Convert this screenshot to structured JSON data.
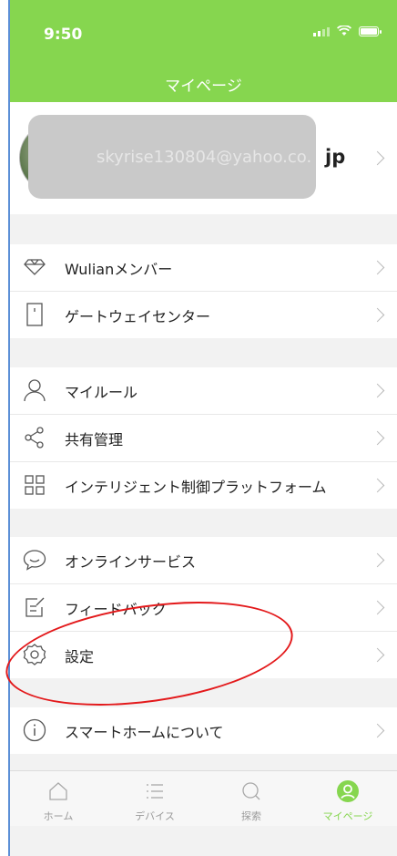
{
  "status": {
    "time": "9:50"
  },
  "header": {
    "title": "マイページ"
  },
  "profile": {
    "email_masked": "skyrise130804@yahoo.co.",
    "email_tail": "jp"
  },
  "groups": [
    {
      "items": [
        {
          "label": "Wulianメンバー",
          "icon": "diamond-icon"
        },
        {
          "label": "ゲートウェイセンター",
          "icon": "door-icon"
        }
      ]
    },
    {
      "items": [
        {
          "label": "マイルール",
          "icon": "user-icon"
        },
        {
          "label": "共有管理",
          "icon": "share-icon"
        },
        {
          "label": "インテリジェント制御プラットフォーム",
          "icon": "grid-icon"
        }
      ]
    },
    {
      "items": [
        {
          "label": "オンラインサービス",
          "icon": "chat-icon"
        },
        {
          "label": "フィードバック",
          "icon": "feedback-icon"
        },
        {
          "label": "設定",
          "icon": "gear-icon"
        }
      ]
    },
    {
      "items": [
        {
          "label": "スマートホームについて",
          "icon": "info-icon"
        }
      ]
    }
  ],
  "tabs": [
    {
      "label": "ホーム",
      "icon": "home-icon"
    },
    {
      "label": "デバイス",
      "icon": "list-icon"
    },
    {
      "label": "探索",
      "icon": "search-icon"
    },
    {
      "label": "マイページ",
      "icon": "profile-icon",
      "active": true
    }
  ],
  "colors": {
    "accent": "#86d64f",
    "annotation": "#e3191b"
  }
}
